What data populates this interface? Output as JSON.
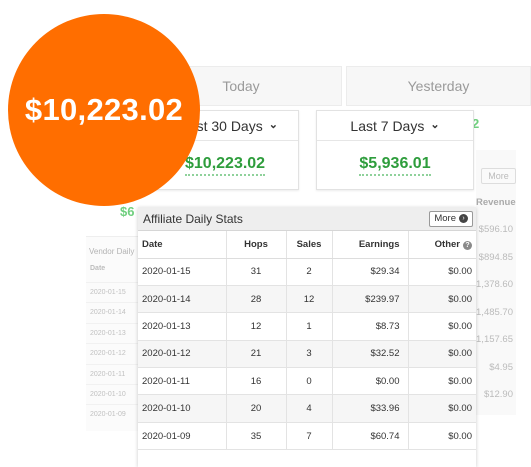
{
  "tabs": {
    "today": "Today",
    "yesterday": "Yesterday"
  },
  "summary": {
    "last30": {
      "label": "Last 30 Days",
      "value": "$10,223.02"
    },
    "last7": {
      "label": "Last 7 Days",
      "value": "$5,936.01"
    }
  },
  "partial": {
    "right_green": "2",
    "left_green": "$6",
    "right_more": "More"
  },
  "right_column": {
    "header": "Revenue",
    "values": [
      "$596.10",
      "$894.85",
      "1,378.60",
      "1,485.70",
      "1,157.65",
      "$4.95",
      "$12.90"
    ]
  },
  "vendor": {
    "title": "Vendor Daily",
    "header": "Date",
    "dates": [
      "2020-01-15",
      "2020-01-14",
      "2020-01-13",
      "2020-01-12",
      "2020-01-11",
      "2020-01-10",
      "2020-01-09"
    ]
  },
  "affiliate": {
    "title": "Affiliate Daily Stats",
    "more_label": "More",
    "columns": [
      "Date",
      "Hops",
      "Sales",
      "Earnings",
      "Other"
    ],
    "rows": [
      [
        "2020-01-15",
        "31",
        "2",
        "$29.34",
        "$0.00"
      ],
      [
        "2020-01-14",
        "28",
        "12",
        "$239.97",
        "$0.00"
      ],
      [
        "2020-01-13",
        "12",
        "1",
        "$8.73",
        "$0.00"
      ],
      [
        "2020-01-12",
        "21",
        "3",
        "$32.52",
        "$0.00"
      ],
      [
        "2020-01-11",
        "16",
        "0",
        "$0.00",
        "$0.00"
      ],
      [
        "2020-01-10",
        "20",
        "4",
        "$33.96",
        "$0.00"
      ],
      [
        "2020-01-09",
        "35",
        "7",
        "$60.74",
        "$0.00"
      ]
    ]
  },
  "badge": {
    "text": "$10,223.02"
  },
  "colors": {
    "badge": "#ff6e00",
    "money_green": "#2e9d3c"
  },
  "icons": {
    "dropdown": "chevron-down-icon",
    "more": "circle-arrow-right-icon",
    "help": "question-circle-icon"
  }
}
